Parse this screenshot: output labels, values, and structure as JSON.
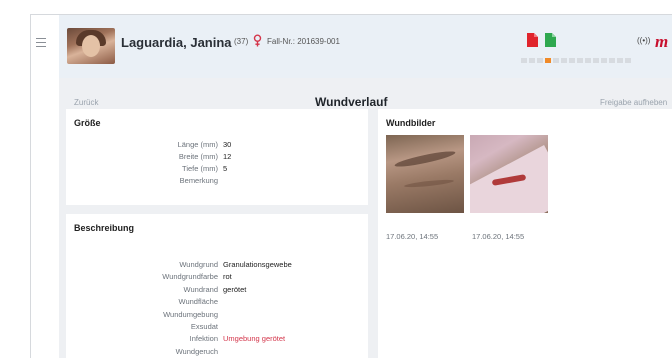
{
  "patient": {
    "name": "Laguardia, Janina",
    "age": "(37)",
    "case_number": "Fall-Nr.: 201639-001"
  },
  "header": {
    "brand": "m",
    "signal": "((•))",
    "progress_steps": 14,
    "progress_active_index": 3
  },
  "subnav": {
    "back_label": "Zurück",
    "title": "Wundverlauf",
    "release_label": "Freigabe aufheben"
  },
  "size_card": {
    "title": "Größe",
    "rows": [
      {
        "label": "Länge (mm)",
        "value": "30"
      },
      {
        "label": "Breite (mm)",
        "value": "12"
      },
      {
        "label": "Tiefe (mm)",
        "value": "5"
      },
      {
        "label": "Bemerkung",
        "value": ""
      }
    ]
  },
  "description_card": {
    "title": "Beschreibung",
    "rows": [
      {
        "label": "Wundgrund",
        "value": "Granulationsgewebe",
        "alert": false
      },
      {
        "label": "Wundgrundfarbe",
        "value": "rot",
        "alert": false
      },
      {
        "label": "Wundrand",
        "value": "gerötet",
        "alert": false
      },
      {
        "label": "Wundfläche",
        "value": "",
        "alert": false
      },
      {
        "label": "Wundumgebung",
        "value": "",
        "alert": false
      },
      {
        "label": "Exsudat",
        "value": "",
        "alert": false
      },
      {
        "label": "Infektion",
        "value": "Umgebung gerötet",
        "alert": true
      },
      {
        "label": "Wundgeruch",
        "value": "",
        "alert": false
      }
    ]
  },
  "images_card": {
    "title": "Wundbilder",
    "images": [
      {
        "date": "17.06.20, 14:55"
      },
      {
        "date": "17.06.20, 14:55"
      }
    ]
  },
  "colors": {
    "accent_orange": "#f08a28",
    "alert_red": "#d4364b",
    "brand_red": "#c8102e",
    "doc_red": "#e0242c",
    "doc_green": "#2fa84f"
  },
  "icons": {
    "menu": "hamburger-icon",
    "gender": "female-icon",
    "doc_red": "document-red-icon",
    "doc_green": "document-green-icon",
    "signal": "nfc-signal-icon"
  }
}
